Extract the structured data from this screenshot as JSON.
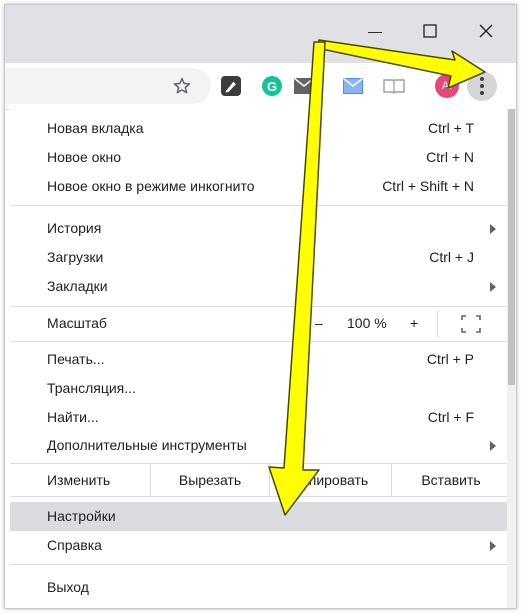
{
  "window": {
    "minimize_glyph": "—",
    "maximize_glyph": "☐",
    "close_glyph": "✕"
  },
  "toolbar": {
    "bookmark_icon": "star-icon",
    "extensions": [
      "pen-extension-icon",
      "grammarly-icon",
      "mail-icon",
      "mail-outline-icon",
      "reader-icon"
    ],
    "grammarly_letter": "G",
    "profile_initials": "AI",
    "profile_color": "#e8457a",
    "menu_icon": "kebab-menu-icon"
  },
  "menu": {
    "new_tab": {
      "label": "Новая вкладка",
      "shortcut": "Ctrl + T"
    },
    "new_window": {
      "label": "Новое окно",
      "shortcut": "Ctrl + N"
    },
    "incognito": {
      "label": "Новое окно в режиме инкогнито",
      "shortcut": "Ctrl + Shift + N"
    },
    "history": {
      "label": "История"
    },
    "downloads": {
      "label": "Загрузки",
      "shortcut": "Ctrl + J"
    },
    "bookmarks": {
      "label": "Закладки"
    },
    "zoom": {
      "label": "Масштаб",
      "minus": "–",
      "value": "100 %",
      "plus": "+"
    },
    "print": {
      "label": "Печать...",
      "shortcut": "Ctrl + P"
    },
    "cast": {
      "label": "Трансляция..."
    },
    "find": {
      "label": "Найти...",
      "shortcut": "Ctrl + F"
    },
    "more_tools": {
      "label": "Дополнительные инструменты"
    },
    "edit": {
      "label": "Изменить",
      "cut": "Вырезать",
      "copy": "Копировать",
      "paste": "Вставить"
    },
    "settings": {
      "label": "Настройки"
    },
    "help": {
      "label": "Справка"
    },
    "exit": {
      "label": "Выход"
    }
  },
  "colors": {
    "accent_arrow": "#ffff00",
    "arrow_outline": "#4a4a00",
    "highlight": "#dadce0"
  }
}
